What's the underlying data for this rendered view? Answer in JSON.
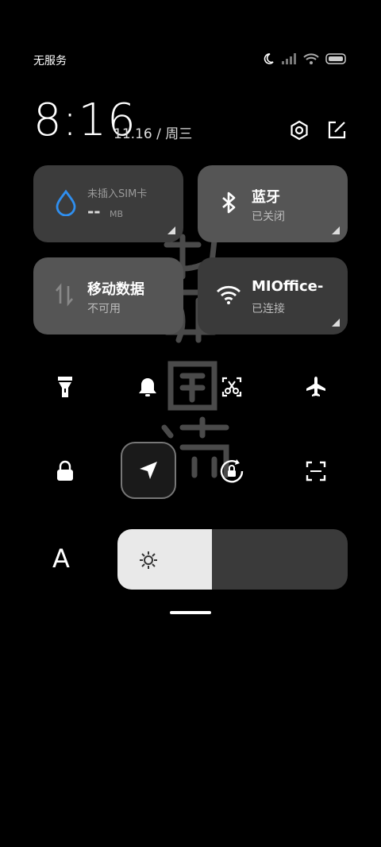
{
  "status_bar": {
    "carrier": "无服务"
  },
  "header": {
    "time": "8:16",
    "date": "11.16 / 周三"
  },
  "tiles": {
    "data_usage": {
      "title": "未插入SIM卡",
      "value": "--",
      "unit": "MB"
    },
    "bluetooth": {
      "title": "蓝牙",
      "status": "已关闭"
    },
    "mobile_data": {
      "title": "移动数据",
      "status": "不可用"
    },
    "wifi": {
      "title": "MIOffice-",
      "status": "已连接"
    }
  },
  "quick_toggles": [
    "flashlight-icon",
    "bell-icon",
    "screenshot-icon",
    "airplane-icon",
    "lock-icon",
    "location-icon",
    "rotation-lock-icon",
    "scan-icon"
  ],
  "brightness": {
    "level": 0.41,
    "auto_label": "A"
  },
  "colors": {
    "tile": "#3a3a3a",
    "accent_blue": "#2f8ff0",
    "slider_fill": "#e9e9e9"
  }
}
